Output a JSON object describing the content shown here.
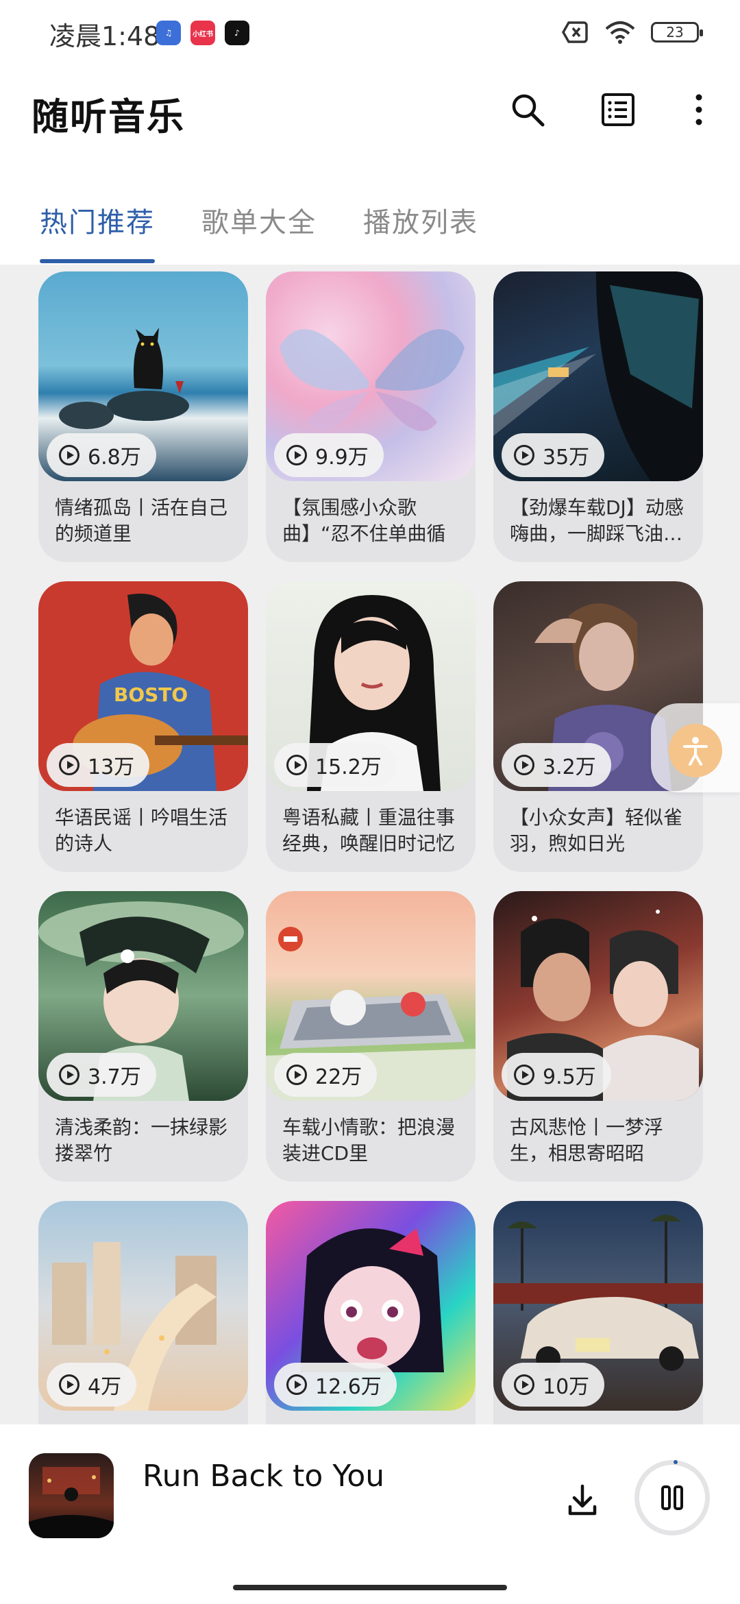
{
  "status_bar": {
    "time": "凌晨1:48",
    "notification_icons": [
      "music-app-icon",
      "xiaohongshu-icon",
      "douyin-icon"
    ],
    "battery_level": "23"
  },
  "header": {
    "title": "随听音乐",
    "icons": [
      "search-icon",
      "list-icon",
      "more-vertical-icon"
    ]
  },
  "tabs": [
    {
      "label": "热门推荐",
      "active": true
    },
    {
      "label": "歌单大全",
      "active": false
    },
    {
      "label": "播放列表",
      "active": false
    }
  ],
  "playlists": [
    {
      "count": "6.8万",
      "title": "情绪孤岛丨活在自己的频道里"
    },
    {
      "count": "9.9万",
      "title": "【氛围感小众歌曲】“忍不住单曲循环！”"
    },
    {
      "count": "35万",
      "title": "【劲爆车载DJ】动感嗨曲，一脚踩飞油…"
    },
    {
      "count": "13万",
      "title": "华语民谣丨吟唱生活的诗人"
    },
    {
      "count": "15.2万",
      "title": "粤语私藏丨重温往事经典，唤醒旧时记忆"
    },
    {
      "count": "3.2万",
      "title": "【小众女声】轻似雀羽，煦如日光"
    },
    {
      "count": "3.7万",
      "title": "清浅柔韵：一抹绿影搂翠竹"
    },
    {
      "count": "22万",
      "title": "车载小情歌：把浪漫装进CD里"
    },
    {
      "count": "9.5万",
      "title": "古风悲怆丨一梦浮生，相思寄昭昭"
    },
    {
      "count": "4万",
      "title": ""
    },
    {
      "count": "12.6万",
      "title": ""
    },
    {
      "count": "10万",
      "title": ""
    }
  ],
  "player": {
    "song_title": "Run Back to You",
    "state": "playing"
  },
  "colors": {
    "accent": "#2d5ea8",
    "tab_inactive": "#8a8a8a",
    "grid_background": "#efeff0",
    "card_background": "#e3e3e6"
  }
}
